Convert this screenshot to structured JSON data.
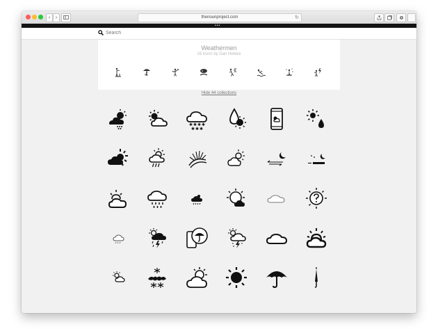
{
  "browser": {
    "url": "thenounproject.com",
    "reload_glyph": "↻",
    "back_glyph": "‹",
    "forward_glyph": "›"
  },
  "topbar": {
    "dots": "•••"
  },
  "search": {
    "placeholder": "Search"
  },
  "collection": {
    "title": "Weathermen",
    "subtitle": "16 icons by Dan Hetteix",
    "preview_icons": [
      "man-pointing-icon",
      "man-umbrella-icon",
      "man-shovel-icon",
      "man-surfing-icon",
      "man-wind-icon",
      "man-swimming-icon",
      "man-snow-icon",
      "man-lightning-icon"
    ]
  },
  "hide_link": "Hide 44 collections",
  "icon_grid": [
    [
      "sun-cloud-snow-icon",
      "sun-cloud-icon",
      "cloud-snow-stars-icon",
      "drop-sun-icon",
      "phone-weather-icon",
      "sun-drop-icon"
    ],
    [
      "sun-cloud-rays-icon",
      "sun-cloud-rain-icon",
      "sunrise-icon",
      "cloud-sun-outline-icon",
      "moon-wind-icon",
      "moon-stars-icon"
    ],
    [
      "sun-behind-cloud-icon",
      "cloud-rain-icon",
      "small-cloud-rain-icon",
      "sun-cloud-outline-icon",
      "thin-cloud-icon",
      "sun-question-icon"
    ],
    [
      "small-cloud-drizzle-icon",
      "sun-cloud-lightning-icon",
      "phone-umbrella-icon",
      "sun-cloud-storm-icon",
      "cloud-outline-icon",
      "sun-cloud-bold-icon"
    ],
    [
      "small-sun-cloud-icon",
      "snowflake-cloud-icon",
      "sun-cloud-large-icon",
      "sun-bold-icon",
      "umbrella-icon",
      "closed-umbrella-icon"
    ]
  ]
}
